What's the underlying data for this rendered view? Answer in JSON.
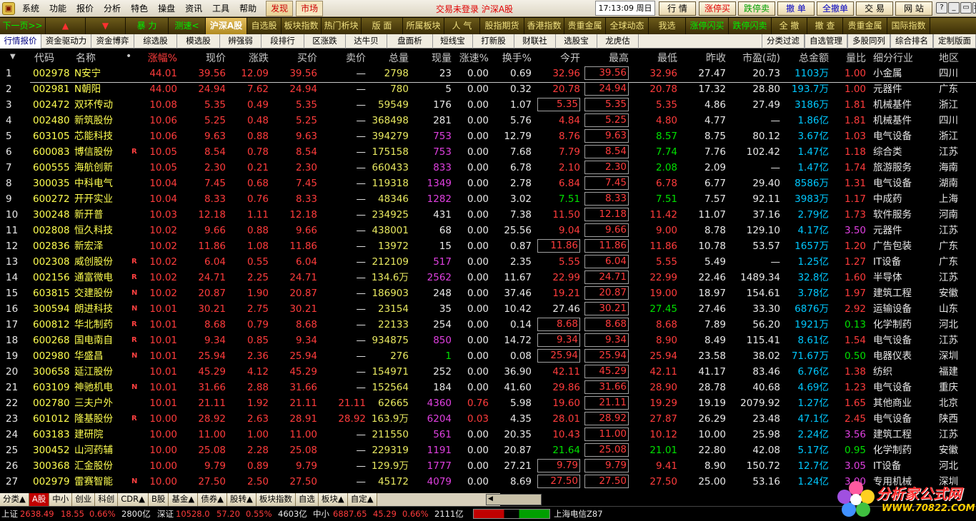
{
  "menu": {
    "icon": "app-logo-icon",
    "items": [
      "系统",
      "功能",
      "报价",
      "分析",
      "特色",
      "操盘",
      "资讯",
      "工具",
      "帮助"
    ],
    "tabs": [
      "发现",
      "市场"
    ],
    "login_status": "交易未登录 沪深A股",
    "clock": "17:13:09 周日",
    "buttons": [
      "行 情",
      "涨停买",
      "跌停卖",
      "撤 单",
      "全撤单",
      "交 易",
      "网 站"
    ]
  },
  "quickbar": [
    {
      "label": "下一页>>",
      "style": "green"
    },
    {
      "label": "▲",
      "style": "red"
    },
    {
      "label": "▼",
      "style": "red"
    },
    {
      "label": "暴 力",
      "style": "green"
    },
    {
      "label": "测速<",
      "style": "green"
    },
    {
      "label": "沪深A股",
      "style": "active"
    },
    {
      "label": "自选股",
      "style": ""
    },
    {
      "label": "板块指数",
      "style": ""
    },
    {
      "label": "热门析块",
      "style": ""
    },
    {
      "label": "版 面",
      "style": ""
    },
    {
      "label": "所属板块",
      "style": ""
    },
    {
      "label": "人 气",
      "style": ""
    },
    {
      "label": "股指期货",
      "style": ""
    },
    {
      "label": "香港指数",
      "style": ""
    },
    {
      "label": "贵重金属",
      "style": ""
    },
    {
      "label": "全球动态",
      "style": ""
    },
    {
      "label": "我选",
      "style": ""
    },
    {
      "label": "涨停闪买",
      "style": "green"
    },
    {
      "label": "跌停闪卖",
      "style": "green"
    },
    {
      "label": "全 撤",
      "style": ""
    },
    {
      "label": "撤 查",
      "style": ""
    },
    {
      "label": "贵重金属",
      "style": ""
    },
    {
      "label": "国际指数",
      "style": ""
    }
  ],
  "subtabs": [
    "行情报价",
    "资金驱动力",
    "资金博弈",
    "综选股",
    "模选股",
    "辨强弱",
    "段排行",
    "区涨跌",
    "达牛贝",
    "盘面析",
    "短线宝",
    "打新股",
    "财联社",
    "选股宝",
    "龙虎估"
  ],
  "subtabs_right": [
    "分类过滤",
    "自选管理",
    "多股同列",
    "综合排名",
    "定制版面"
  ],
  "columns": [
    "代码",
    "名称",
    "•",
    "涨幅%",
    "现价",
    "涨跌",
    "买价",
    "卖价",
    "总量",
    "现量",
    "涨速%",
    "换手%",
    "今开",
    "最高",
    "最低",
    "昨收",
    "市盈(动)",
    "总金额",
    "量比",
    "细分行业",
    "地区"
  ],
  "rows": [
    {
      "n": "1",
      "code": "002978",
      "name": "N安宁",
      "mark": "",
      "pct": "44.01",
      "price": "39.56",
      "chg": "12.09",
      "bid": "39.56",
      "ask": "—",
      "vol": "2798",
      "cur": "23",
      "speed": "0.00",
      "turn": "0.69",
      "open": "32.96",
      "high": "39.56",
      "low": "32.96",
      "prev": "27.47",
      "pe": "20.73",
      "amt": "1103万",
      "qr": "1.00",
      "ind": "小金属",
      "reg": "四川"
    },
    {
      "n": "2",
      "code": "002981",
      "name": "N朝阳",
      "mark": "",
      "pct": "44.00",
      "price": "24.94",
      "chg": "7.62",
      "bid": "24.94",
      "ask": "—",
      "vol": "780",
      "cur": "5",
      "speed": "0.00",
      "turn": "0.32",
      "open": "20.78",
      "high": "24.94",
      "low": "20.78",
      "prev": "17.32",
      "pe": "28.80",
      "amt": "193.7万",
      "qr": "1.00",
      "ind": "元器件",
      "reg": "广东"
    },
    {
      "n": "3",
      "code": "002472",
      "name": "双环传动",
      "mark": "",
      "pct": "10.08",
      "price": "5.35",
      "chg": "0.49",
      "bid": "5.35",
      "ask": "—",
      "vol": "59549",
      "cur": "176",
      "speed": "0.00",
      "turn": "1.07",
      "open": "5.35",
      "high": "5.35",
      "low": "5.35",
      "prev": "4.86",
      "pe": "27.49",
      "amt": "3186万",
      "qr": "1.81",
      "ind": "机械基件",
      "reg": "浙江"
    },
    {
      "n": "4",
      "code": "002480",
      "name": "新筑股份",
      "mark": "",
      "pct": "10.06",
      "price": "5.25",
      "chg": "0.48",
      "bid": "5.25",
      "ask": "—",
      "vol": "368498",
      "cur": "281",
      "speed": "0.00",
      "turn": "5.76",
      "open": "4.84",
      "high": "5.25",
      "low": "4.80",
      "prev": "4.77",
      "pe": "—",
      "amt": "1.86亿",
      "qr": "1.81",
      "ind": "机械基件",
      "reg": "四川"
    },
    {
      "n": "5",
      "code": "603105",
      "name": "芯能科技",
      "mark": "",
      "pct": "10.06",
      "price": "9.63",
      "chg": "0.88",
      "bid": "9.63",
      "ask": "—",
      "vol": "394279",
      "cur": "753",
      "speed": "0.00",
      "turn": "12.79",
      "open": "8.76",
      "high": "9.63",
      "low": "8.57",
      "prev": "8.75",
      "pe": "80.12",
      "amt": "3.67亿",
      "qr": "1.03",
      "ind": "电气设备",
      "reg": "浙江"
    },
    {
      "n": "6",
      "code": "600083",
      "name": "博信股份",
      "mark": "R",
      "pct": "10.05",
      "price": "8.54",
      "chg": "0.78",
      "bid": "8.54",
      "ask": "—",
      "vol": "175158",
      "cur": "753",
      "speed": "0.00",
      "turn": "7.68",
      "open": "7.79",
      "high": "8.54",
      "low": "7.74",
      "prev": "7.76",
      "pe": "102.42",
      "amt": "1.47亿",
      "qr": "1.18",
      "ind": "综合类",
      "reg": "江苏"
    },
    {
      "n": "7",
      "code": "600555",
      "name": "海航创新",
      "mark": "",
      "pct": "10.05",
      "price": "2.30",
      "chg": "0.21",
      "bid": "2.30",
      "ask": "—",
      "vol": "660433",
      "cur": "833",
      "speed": "0.00",
      "turn": "6.78",
      "open": "2.10",
      "high": "2.30",
      "low": "2.08",
      "prev": "2.09",
      "pe": "—",
      "amt": "1.47亿",
      "qr": "1.74",
      "ind": "旅游服务",
      "reg": "海南"
    },
    {
      "n": "8",
      "code": "300035",
      "name": "中科电气",
      "mark": "",
      "pct": "10.04",
      "price": "7.45",
      "chg": "0.68",
      "bid": "7.45",
      "ask": "—",
      "vol": "119318",
      "cur": "1349",
      "speed": "0.00",
      "turn": "2.78",
      "open": "6.84",
      "high": "7.45",
      "low": "6.78",
      "prev": "6.77",
      "pe": "29.40",
      "amt": "8586万",
      "qr": "1.31",
      "ind": "电气设备",
      "reg": "湖南"
    },
    {
      "n": "9",
      "code": "600272",
      "name": "开开实业",
      "mark": "",
      "pct": "10.04",
      "price": "8.33",
      "chg": "0.76",
      "bid": "8.33",
      "ask": "—",
      "vol": "48346",
      "cur": "1282",
      "speed": "0.00",
      "turn": "3.02",
      "open": "7.51",
      "high": "8.33",
      "low": "7.51",
      "prev": "7.57",
      "pe": "92.11",
      "amt": "3983万",
      "qr": "1.17",
      "ind": "中成药",
      "reg": "上海"
    },
    {
      "n": "10",
      "code": "300248",
      "name": "新开普",
      "mark": "",
      "pct": "10.03",
      "price": "12.18",
      "chg": "1.11",
      "bid": "12.18",
      "ask": "—",
      "vol": "234925",
      "cur": "431",
      "speed": "0.00",
      "turn": "7.38",
      "open": "11.50",
      "high": "12.18",
      "low": "11.42",
      "prev": "11.07",
      "pe": "37.16",
      "amt": "2.79亿",
      "qr": "1.73",
      "ind": "软件服务",
      "reg": "河南"
    },
    {
      "n": "11",
      "code": "002808",
      "name": "恒久科技",
      "mark": "",
      "pct": "10.02",
      "price": "9.66",
      "chg": "0.88",
      "bid": "9.66",
      "ask": "—",
      "vol": "438001",
      "cur": "68",
      "speed": "0.00",
      "turn": "25.56",
      "open": "9.04",
      "high": "9.66",
      "low": "9.00",
      "prev": "8.78",
      "pe": "129.10",
      "amt": "4.17亿",
      "qr": "3.50",
      "ind": "元器件",
      "reg": "江苏"
    },
    {
      "n": "12",
      "code": "002836",
      "name": "新宏泽",
      "mark": "",
      "pct": "10.02",
      "price": "11.86",
      "chg": "1.08",
      "bid": "11.86",
      "ask": "—",
      "vol": "13972",
      "cur": "15",
      "speed": "0.00",
      "turn": "0.87",
      "open": "11.86",
      "high": "11.86",
      "low": "11.86",
      "prev": "10.78",
      "pe": "53.57",
      "amt": "1657万",
      "qr": "1.20",
      "ind": "广告包装",
      "reg": "广东"
    },
    {
      "n": "13",
      "code": "002308",
      "name": "威创股份",
      "mark": "R",
      "pct": "10.02",
      "price": "6.04",
      "chg": "0.55",
      "bid": "6.04",
      "ask": "—",
      "vol": "212109",
      "cur": "517",
      "speed": "0.00",
      "turn": "2.35",
      "open": "5.55",
      "high": "6.04",
      "low": "5.55",
      "prev": "5.49",
      "pe": "—",
      "amt": "1.25亿",
      "qr": "1.27",
      "ind": "IT设备",
      "reg": "广东"
    },
    {
      "n": "14",
      "code": "002156",
      "name": "通富微电",
      "mark": "R",
      "pct": "10.02",
      "price": "24.71",
      "chg": "2.25",
      "bid": "24.71",
      "ask": "—",
      "vol": "134.6万",
      "cur": "2562",
      "speed": "0.00",
      "turn": "11.67",
      "open": "22.99",
      "high": "24.71",
      "low": "22.99",
      "prev": "22.46",
      "pe": "1489.34",
      "amt": "32.8亿",
      "qr": "1.60",
      "ind": "半导体",
      "reg": "江苏"
    },
    {
      "n": "15",
      "code": "603815",
      "name": "交建股份",
      "mark": "N",
      "pct": "10.02",
      "price": "20.87",
      "chg": "1.90",
      "bid": "20.87",
      "ask": "—",
      "vol": "186903",
      "cur": "248",
      "speed": "0.00",
      "turn": "37.46",
      "open": "19.21",
      "high": "20.87",
      "low": "19.00",
      "prev": "18.97",
      "pe": "154.61",
      "amt": "3.78亿",
      "qr": "1.97",
      "ind": "建筑工程",
      "reg": "安徽"
    },
    {
      "n": "16",
      "code": "300594",
      "name": "朗进科技",
      "mark": "N",
      "pct": "10.01",
      "price": "30.21",
      "chg": "2.75",
      "bid": "30.21",
      "ask": "—",
      "vol": "23154",
      "cur": "35",
      "speed": "0.00",
      "turn": "10.42",
      "open": "27.46",
      "high": "30.21",
      "low": "27.45",
      "prev": "27.46",
      "pe": "33.30",
      "amt": "6876万",
      "qr": "2.92",
      "ind": "运输设备",
      "reg": "山东"
    },
    {
      "n": "17",
      "code": "600812",
      "name": "华北制药",
      "mark": "R",
      "pct": "10.01",
      "price": "8.68",
      "chg": "0.79",
      "bid": "8.68",
      "ask": "—",
      "vol": "22133",
      "cur": "254",
      "speed": "0.00",
      "turn": "0.14",
      "open": "8.68",
      "high": "8.68",
      "low": "8.68",
      "prev": "7.89",
      "pe": "56.20",
      "amt": "1921万",
      "qr": "0.13",
      "ind": "化学制药",
      "reg": "河北"
    },
    {
      "n": "18",
      "code": "600268",
      "name": "国电南自",
      "mark": "R",
      "pct": "10.01",
      "price": "9.34",
      "chg": "0.85",
      "bid": "9.34",
      "ask": "—",
      "vol": "934875",
      "cur": "850",
      "speed": "0.00",
      "turn": "14.72",
      "open": "9.34",
      "high": "9.34",
      "low": "8.90",
      "prev": "8.49",
      "pe": "115.41",
      "amt": "8.61亿",
      "qr": "1.54",
      "ind": "电气设备",
      "reg": "江苏"
    },
    {
      "n": "19",
      "code": "002980",
      "name": "华盛昌",
      "mark": "N",
      "pct": "10.01",
      "price": "25.94",
      "chg": "2.36",
      "bid": "25.94",
      "ask": "—",
      "vol": "276",
      "cur": "1",
      "speed": "0.00",
      "turn": "0.08",
      "open": "25.94",
      "high": "25.94",
      "low": "25.94",
      "prev": "23.58",
      "pe": "38.02",
      "amt": "71.67万",
      "qr": "0.50",
      "ind": "电器仪表",
      "reg": "深圳"
    },
    {
      "n": "20",
      "code": "300658",
      "name": "延江股份",
      "mark": "",
      "pct": "10.01",
      "price": "45.29",
      "chg": "4.12",
      "bid": "45.29",
      "ask": "—",
      "vol": "154971",
      "cur": "252",
      "speed": "0.00",
      "turn": "36.90",
      "open": "42.11",
      "high": "45.29",
      "low": "42.11",
      "prev": "41.17",
      "pe": "83.46",
      "amt": "6.76亿",
      "qr": "1.38",
      "ind": "纺织",
      "reg": "福建"
    },
    {
      "n": "21",
      "code": "603109",
      "name": "神驰机电",
      "mark": "N",
      "pct": "10.01",
      "price": "31.66",
      "chg": "2.88",
      "bid": "31.66",
      "ask": "—",
      "vol": "152564",
      "cur": "184",
      "speed": "0.00",
      "turn": "41.60",
      "open": "29.86",
      "high": "31.66",
      "low": "28.90",
      "prev": "28.78",
      "pe": "40.68",
      "amt": "4.69亿",
      "qr": "1.23",
      "ind": "电气设备",
      "reg": "重庆"
    },
    {
      "n": "22",
      "code": "002780",
      "name": "三夫户外",
      "mark": "",
      "pct": "10.01",
      "price": "21.11",
      "chg": "1.92",
      "bid": "21.11",
      "ask": "21.11",
      "vol": "62665",
      "cur": "4360",
      "speed": "0.76",
      "turn": "5.98",
      "open": "19.60",
      "high": "21.11",
      "low": "19.29",
      "prev": "19.19",
      "pe": "2079.92",
      "amt": "1.27亿",
      "qr": "1.65",
      "ind": "其他商业",
      "reg": "北京"
    },
    {
      "n": "23",
      "code": "601012",
      "name": "隆基股份",
      "mark": "R",
      "pct": "10.00",
      "price": "28.92",
      "chg": "2.63",
      "bid": "28.91",
      "ask": "28.92",
      "vol": "163.9万",
      "cur": "6204",
      "speed": "0.03",
      "turn": "4.35",
      "open": "28.01",
      "high": "28.92",
      "low": "27.87",
      "prev": "26.29",
      "pe": "23.48",
      "amt": "47.1亿",
      "qr": "2.45",
      "ind": "电气设备",
      "reg": "陕西"
    },
    {
      "n": "24",
      "code": "603183",
      "name": "建研院",
      "mark": "",
      "pct": "10.00",
      "price": "11.00",
      "chg": "1.00",
      "bid": "11.00",
      "ask": "—",
      "vol": "211550",
      "cur": "561",
      "speed": "0.00",
      "turn": "20.35",
      "open": "10.43",
      "high": "11.00",
      "low": "10.12",
      "prev": "10.00",
      "pe": "25.98",
      "amt": "2.24亿",
      "qr": "3.56",
      "ind": "建筑工程",
      "reg": "江苏"
    },
    {
      "n": "25",
      "code": "300452",
      "name": "山河药辅",
      "mark": "",
      "pct": "10.00",
      "price": "25.08",
      "chg": "2.28",
      "bid": "25.08",
      "ask": "—",
      "vol": "229319",
      "cur": "1191",
      "speed": "0.00",
      "turn": "20.87",
      "open": "21.64",
      "high": "25.08",
      "low": "21.01",
      "prev": "22.80",
      "pe": "42.08",
      "amt": "5.17亿",
      "qr": "0.95",
      "ind": "化学制药",
      "reg": "安徽"
    },
    {
      "n": "26",
      "code": "300368",
      "name": "汇金股份",
      "mark": "",
      "pct": "10.00",
      "price": "9.79",
      "chg": "0.89",
      "bid": "9.79",
      "ask": "—",
      "vol": "129.9万",
      "cur": "1777",
      "speed": "0.00",
      "turn": "27.21",
      "open": "9.79",
      "high": "9.79",
      "low": "9.41",
      "prev": "8.90",
      "pe": "150.72",
      "amt": "12.7亿",
      "qr": "3.05",
      "ind": "IT设备",
      "reg": "河北"
    },
    {
      "n": "27",
      "code": "002979",
      "name": "雷赛智能",
      "mark": "N",
      "pct": "10.00",
      "price": "27.50",
      "chg": "2.50",
      "bid": "27.50",
      "ask": "—",
      "vol": "45172",
      "cur": "4079",
      "speed": "0.00",
      "turn": "8.69",
      "open": "27.50",
      "high": "27.50",
      "low": "27.50",
      "prev": "25.00",
      "pe": "53.16",
      "amt": "1.24亿",
      "qr": "3.00",
      "ind": "专用机械",
      "reg": "深圳"
    }
  ],
  "bottom_tabs": [
    "分类▲",
    "A股",
    "中小",
    "创业",
    "科创",
    "CDR▲",
    "B股",
    "基金▲",
    "债券▲",
    "股转▲",
    "板块指数",
    "自选",
    "板块▲",
    "自定▲"
  ],
  "status": {
    "sh_label": "上证",
    "sh_val": "2638.49",
    "sh_chg": "18.55",
    "sh_pct": "0.66%",
    "sh_amt": "2800亿",
    "sz_label": "深证",
    "sz_val": "10528.0",
    "sz_chg": "57.20",
    "sz_pct": "0.55%",
    "sz_amt": "4603亿",
    "zx_label": "中小",
    "zx_val": "6887.65",
    "zx_chg": "45.29",
    "zx_pct": "0.66%",
    "zx_amt": "2111亿",
    "server": "上海电信Z87"
  },
  "watermark": {
    "title": "分析家公式网",
    "url": "WWW.70822.COM"
  },
  "colors": {
    "up": "#ff3c3c",
    "down": "#00e000",
    "neutral": "#e8e8e8",
    "code": "#ffff50",
    "name": "#ffff50",
    "volume": "#e8e860",
    "purple": "#e040e0",
    "amount": "#00c8ff"
  }
}
